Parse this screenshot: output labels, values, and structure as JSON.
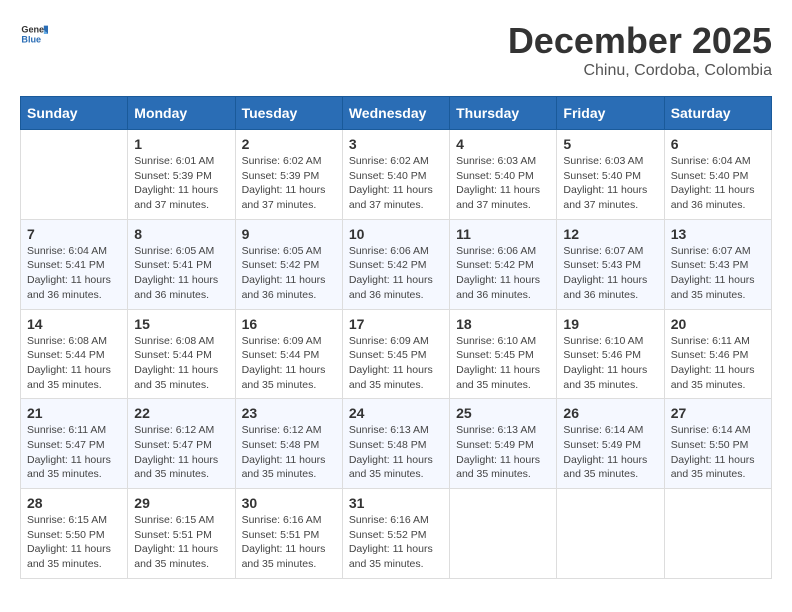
{
  "header": {
    "logo_general": "General",
    "logo_blue": "Blue",
    "month_year": "December 2025",
    "location": "Chinu, Cordoba, Colombia"
  },
  "weekdays": [
    "Sunday",
    "Monday",
    "Tuesday",
    "Wednesday",
    "Thursday",
    "Friday",
    "Saturday"
  ],
  "weeks": [
    [
      {
        "day": "",
        "sunrise": "",
        "sunset": "",
        "daylight": ""
      },
      {
        "day": "1",
        "sunrise": "Sunrise: 6:01 AM",
        "sunset": "Sunset: 5:39 PM",
        "daylight": "Daylight: 11 hours and 37 minutes."
      },
      {
        "day": "2",
        "sunrise": "Sunrise: 6:02 AM",
        "sunset": "Sunset: 5:39 PM",
        "daylight": "Daylight: 11 hours and 37 minutes."
      },
      {
        "day": "3",
        "sunrise": "Sunrise: 6:02 AM",
        "sunset": "Sunset: 5:40 PM",
        "daylight": "Daylight: 11 hours and 37 minutes."
      },
      {
        "day": "4",
        "sunrise": "Sunrise: 6:03 AM",
        "sunset": "Sunset: 5:40 PM",
        "daylight": "Daylight: 11 hours and 37 minutes."
      },
      {
        "day": "5",
        "sunrise": "Sunrise: 6:03 AM",
        "sunset": "Sunset: 5:40 PM",
        "daylight": "Daylight: 11 hours and 37 minutes."
      },
      {
        "day": "6",
        "sunrise": "Sunrise: 6:04 AM",
        "sunset": "Sunset: 5:40 PM",
        "daylight": "Daylight: 11 hours and 36 minutes."
      }
    ],
    [
      {
        "day": "7",
        "sunrise": "Sunrise: 6:04 AM",
        "sunset": "Sunset: 5:41 PM",
        "daylight": "Daylight: 11 hours and 36 minutes."
      },
      {
        "day": "8",
        "sunrise": "Sunrise: 6:05 AM",
        "sunset": "Sunset: 5:41 PM",
        "daylight": "Daylight: 11 hours and 36 minutes."
      },
      {
        "day": "9",
        "sunrise": "Sunrise: 6:05 AM",
        "sunset": "Sunset: 5:42 PM",
        "daylight": "Daylight: 11 hours and 36 minutes."
      },
      {
        "day": "10",
        "sunrise": "Sunrise: 6:06 AM",
        "sunset": "Sunset: 5:42 PM",
        "daylight": "Daylight: 11 hours and 36 minutes."
      },
      {
        "day": "11",
        "sunrise": "Sunrise: 6:06 AM",
        "sunset": "Sunset: 5:42 PM",
        "daylight": "Daylight: 11 hours and 36 minutes."
      },
      {
        "day": "12",
        "sunrise": "Sunrise: 6:07 AM",
        "sunset": "Sunset: 5:43 PM",
        "daylight": "Daylight: 11 hours and 36 minutes."
      },
      {
        "day": "13",
        "sunrise": "Sunrise: 6:07 AM",
        "sunset": "Sunset: 5:43 PM",
        "daylight": "Daylight: 11 hours and 35 minutes."
      }
    ],
    [
      {
        "day": "14",
        "sunrise": "Sunrise: 6:08 AM",
        "sunset": "Sunset: 5:44 PM",
        "daylight": "Daylight: 11 hours and 35 minutes."
      },
      {
        "day": "15",
        "sunrise": "Sunrise: 6:08 AM",
        "sunset": "Sunset: 5:44 PM",
        "daylight": "Daylight: 11 hours and 35 minutes."
      },
      {
        "day": "16",
        "sunrise": "Sunrise: 6:09 AM",
        "sunset": "Sunset: 5:44 PM",
        "daylight": "Daylight: 11 hours and 35 minutes."
      },
      {
        "day": "17",
        "sunrise": "Sunrise: 6:09 AM",
        "sunset": "Sunset: 5:45 PM",
        "daylight": "Daylight: 11 hours and 35 minutes."
      },
      {
        "day": "18",
        "sunrise": "Sunrise: 6:10 AM",
        "sunset": "Sunset: 5:45 PM",
        "daylight": "Daylight: 11 hours and 35 minutes."
      },
      {
        "day": "19",
        "sunrise": "Sunrise: 6:10 AM",
        "sunset": "Sunset: 5:46 PM",
        "daylight": "Daylight: 11 hours and 35 minutes."
      },
      {
        "day": "20",
        "sunrise": "Sunrise: 6:11 AM",
        "sunset": "Sunset: 5:46 PM",
        "daylight": "Daylight: 11 hours and 35 minutes."
      }
    ],
    [
      {
        "day": "21",
        "sunrise": "Sunrise: 6:11 AM",
        "sunset": "Sunset: 5:47 PM",
        "daylight": "Daylight: 11 hours and 35 minutes."
      },
      {
        "day": "22",
        "sunrise": "Sunrise: 6:12 AM",
        "sunset": "Sunset: 5:47 PM",
        "daylight": "Daylight: 11 hours and 35 minutes."
      },
      {
        "day": "23",
        "sunrise": "Sunrise: 6:12 AM",
        "sunset": "Sunset: 5:48 PM",
        "daylight": "Daylight: 11 hours and 35 minutes."
      },
      {
        "day": "24",
        "sunrise": "Sunrise: 6:13 AM",
        "sunset": "Sunset: 5:48 PM",
        "daylight": "Daylight: 11 hours and 35 minutes."
      },
      {
        "day": "25",
        "sunrise": "Sunrise: 6:13 AM",
        "sunset": "Sunset: 5:49 PM",
        "daylight": "Daylight: 11 hours and 35 minutes."
      },
      {
        "day": "26",
        "sunrise": "Sunrise: 6:14 AM",
        "sunset": "Sunset: 5:49 PM",
        "daylight": "Daylight: 11 hours and 35 minutes."
      },
      {
        "day": "27",
        "sunrise": "Sunrise: 6:14 AM",
        "sunset": "Sunset: 5:50 PM",
        "daylight": "Daylight: 11 hours and 35 minutes."
      }
    ],
    [
      {
        "day": "28",
        "sunrise": "Sunrise: 6:15 AM",
        "sunset": "Sunset: 5:50 PM",
        "daylight": "Daylight: 11 hours and 35 minutes."
      },
      {
        "day": "29",
        "sunrise": "Sunrise: 6:15 AM",
        "sunset": "Sunset: 5:51 PM",
        "daylight": "Daylight: 11 hours and 35 minutes."
      },
      {
        "day": "30",
        "sunrise": "Sunrise: 6:16 AM",
        "sunset": "Sunset: 5:51 PM",
        "daylight": "Daylight: 11 hours and 35 minutes."
      },
      {
        "day": "31",
        "sunrise": "Sunrise: 6:16 AM",
        "sunset": "Sunset: 5:52 PM",
        "daylight": "Daylight: 11 hours and 35 minutes."
      },
      {
        "day": "",
        "sunrise": "",
        "sunset": "",
        "daylight": ""
      },
      {
        "day": "",
        "sunrise": "",
        "sunset": "",
        "daylight": ""
      },
      {
        "day": "",
        "sunrise": "",
        "sunset": "",
        "daylight": ""
      }
    ]
  ]
}
